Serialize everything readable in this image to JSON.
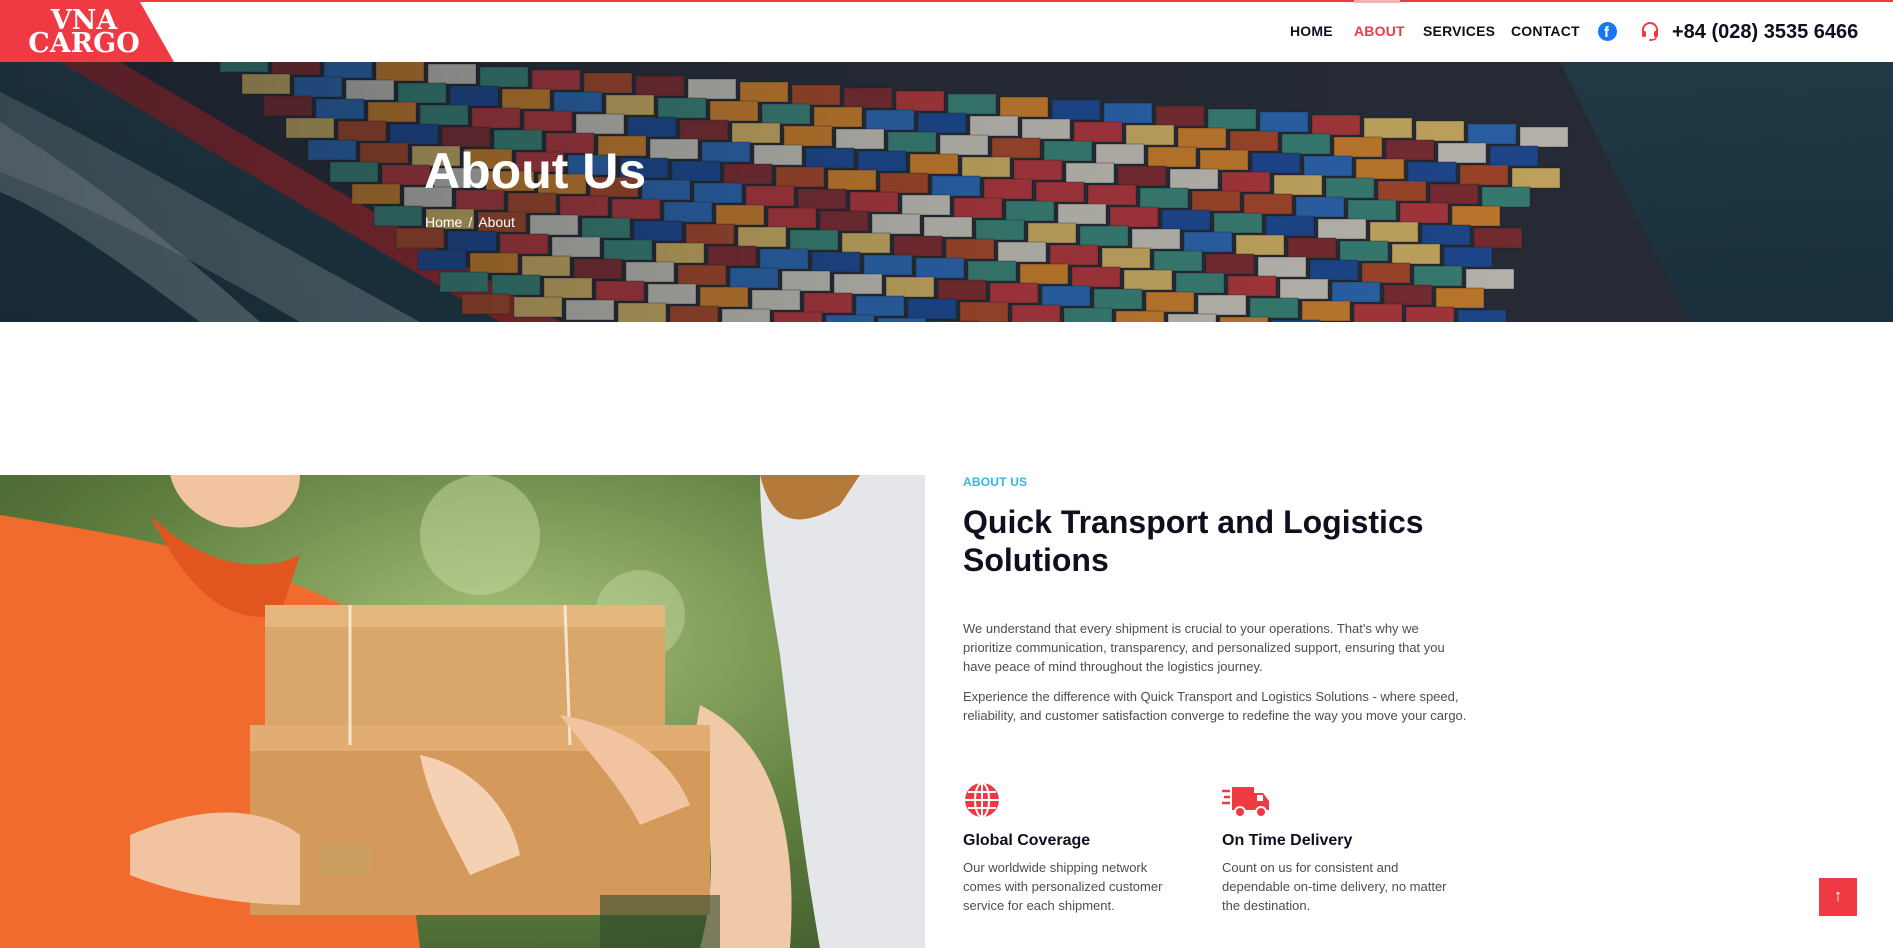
{
  "brand": {
    "logo_line1": "VNA",
    "logo_line2": "CARGO",
    "accent_color": "#ef3a43"
  },
  "nav": {
    "items": [
      {
        "label": "HOME"
      },
      {
        "label": "ABOUT",
        "active": true
      },
      {
        "label": "SERVICES"
      },
      {
        "label": "CONTACT"
      }
    ],
    "facebook_icon": "facebook-icon",
    "phone_icon": "headset-icon",
    "phone": "+84 (028) 3535 6466"
  },
  "hero": {
    "title": "About Us",
    "breadcrumb": {
      "home": "Home",
      "separator": "/",
      "current": "About"
    }
  },
  "about": {
    "eyebrow": "ABOUT US",
    "heading": "Quick Transport and Logistics Solutions",
    "paragraph1": "We understand that every shipment is crucial to your operations. That's why we prioritize communication, transparency, and personalized support, ensuring that you have peace of mind throughout the logistics journey.",
    "paragraph2": "Experience the difference with Quick Transport and Logistics Solutions - where speed, reliability, and customer satisfaction converge to redefine the way you move your cargo.",
    "features": [
      {
        "icon": "globe-icon",
        "title": "Global Coverage",
        "text": "Our worldwide shipping network comes with personalized customer service for each shipment."
      },
      {
        "icon": "fast-truck-icon",
        "title": "On Time Delivery",
        "text": "Count on us for consistent and dependable on-time delivery, no matter the destination."
      }
    ]
  },
  "scroll_top": {
    "icon": "arrow-up-icon",
    "glyph": "↑"
  }
}
